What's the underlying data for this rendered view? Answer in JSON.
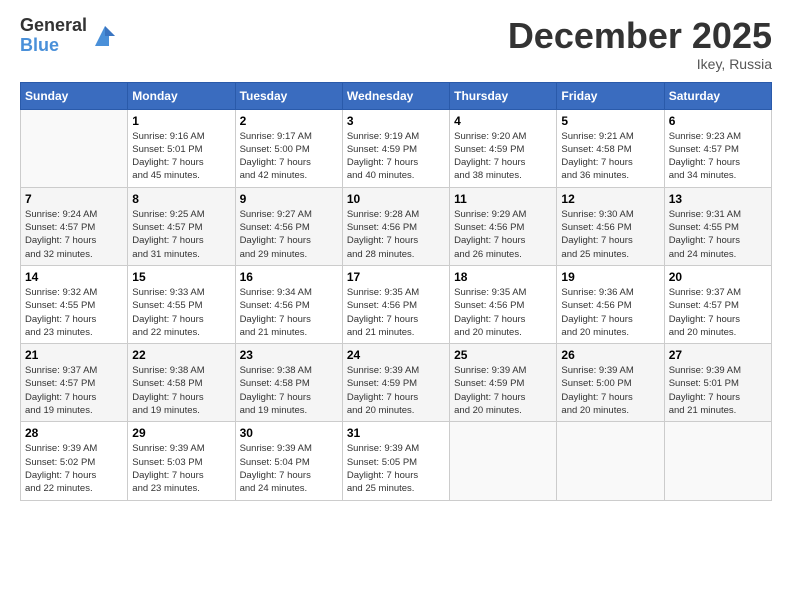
{
  "header": {
    "logo_general": "General",
    "logo_blue": "Blue",
    "title": "December 2025",
    "location": "Ikey, Russia"
  },
  "days_of_week": [
    "Sunday",
    "Monday",
    "Tuesday",
    "Wednesday",
    "Thursday",
    "Friday",
    "Saturday"
  ],
  "weeks": [
    {
      "days": [
        {
          "num": "",
          "info": ""
        },
        {
          "num": "1",
          "info": "Sunrise: 9:16 AM\nSunset: 5:01 PM\nDaylight: 7 hours\nand 45 minutes."
        },
        {
          "num": "2",
          "info": "Sunrise: 9:17 AM\nSunset: 5:00 PM\nDaylight: 7 hours\nand 42 minutes."
        },
        {
          "num": "3",
          "info": "Sunrise: 9:19 AM\nSunset: 4:59 PM\nDaylight: 7 hours\nand 40 minutes."
        },
        {
          "num": "4",
          "info": "Sunrise: 9:20 AM\nSunset: 4:59 PM\nDaylight: 7 hours\nand 38 minutes."
        },
        {
          "num": "5",
          "info": "Sunrise: 9:21 AM\nSunset: 4:58 PM\nDaylight: 7 hours\nand 36 minutes."
        },
        {
          "num": "6",
          "info": "Sunrise: 9:23 AM\nSunset: 4:57 PM\nDaylight: 7 hours\nand 34 minutes."
        }
      ]
    },
    {
      "days": [
        {
          "num": "7",
          "info": "Sunrise: 9:24 AM\nSunset: 4:57 PM\nDaylight: 7 hours\nand 32 minutes."
        },
        {
          "num": "8",
          "info": "Sunrise: 9:25 AM\nSunset: 4:57 PM\nDaylight: 7 hours\nand 31 minutes."
        },
        {
          "num": "9",
          "info": "Sunrise: 9:27 AM\nSunset: 4:56 PM\nDaylight: 7 hours\nand 29 minutes."
        },
        {
          "num": "10",
          "info": "Sunrise: 9:28 AM\nSunset: 4:56 PM\nDaylight: 7 hours\nand 28 minutes."
        },
        {
          "num": "11",
          "info": "Sunrise: 9:29 AM\nSunset: 4:56 PM\nDaylight: 7 hours\nand 26 minutes."
        },
        {
          "num": "12",
          "info": "Sunrise: 9:30 AM\nSunset: 4:56 PM\nDaylight: 7 hours\nand 25 minutes."
        },
        {
          "num": "13",
          "info": "Sunrise: 9:31 AM\nSunset: 4:55 PM\nDaylight: 7 hours\nand 24 minutes."
        }
      ]
    },
    {
      "days": [
        {
          "num": "14",
          "info": "Sunrise: 9:32 AM\nSunset: 4:55 PM\nDaylight: 7 hours\nand 23 minutes."
        },
        {
          "num": "15",
          "info": "Sunrise: 9:33 AM\nSunset: 4:55 PM\nDaylight: 7 hours\nand 22 minutes."
        },
        {
          "num": "16",
          "info": "Sunrise: 9:34 AM\nSunset: 4:56 PM\nDaylight: 7 hours\nand 21 minutes."
        },
        {
          "num": "17",
          "info": "Sunrise: 9:35 AM\nSunset: 4:56 PM\nDaylight: 7 hours\nand 21 minutes."
        },
        {
          "num": "18",
          "info": "Sunrise: 9:35 AM\nSunset: 4:56 PM\nDaylight: 7 hours\nand 20 minutes."
        },
        {
          "num": "19",
          "info": "Sunrise: 9:36 AM\nSunset: 4:56 PM\nDaylight: 7 hours\nand 20 minutes."
        },
        {
          "num": "20",
          "info": "Sunrise: 9:37 AM\nSunset: 4:57 PM\nDaylight: 7 hours\nand 20 minutes."
        }
      ]
    },
    {
      "days": [
        {
          "num": "21",
          "info": "Sunrise: 9:37 AM\nSunset: 4:57 PM\nDaylight: 7 hours\nand 19 minutes."
        },
        {
          "num": "22",
          "info": "Sunrise: 9:38 AM\nSunset: 4:58 PM\nDaylight: 7 hours\nand 19 minutes."
        },
        {
          "num": "23",
          "info": "Sunrise: 9:38 AM\nSunset: 4:58 PM\nDaylight: 7 hours\nand 19 minutes."
        },
        {
          "num": "24",
          "info": "Sunrise: 9:39 AM\nSunset: 4:59 PM\nDaylight: 7 hours\nand 20 minutes."
        },
        {
          "num": "25",
          "info": "Sunrise: 9:39 AM\nSunset: 4:59 PM\nDaylight: 7 hours\nand 20 minutes."
        },
        {
          "num": "26",
          "info": "Sunrise: 9:39 AM\nSunset: 5:00 PM\nDaylight: 7 hours\nand 20 minutes."
        },
        {
          "num": "27",
          "info": "Sunrise: 9:39 AM\nSunset: 5:01 PM\nDaylight: 7 hours\nand 21 minutes."
        }
      ]
    },
    {
      "days": [
        {
          "num": "28",
          "info": "Sunrise: 9:39 AM\nSunset: 5:02 PM\nDaylight: 7 hours\nand 22 minutes."
        },
        {
          "num": "29",
          "info": "Sunrise: 9:39 AM\nSunset: 5:03 PM\nDaylight: 7 hours\nand 23 minutes."
        },
        {
          "num": "30",
          "info": "Sunrise: 9:39 AM\nSunset: 5:04 PM\nDaylight: 7 hours\nand 24 minutes."
        },
        {
          "num": "31",
          "info": "Sunrise: 9:39 AM\nSunset: 5:05 PM\nDaylight: 7 hours\nand 25 minutes."
        },
        {
          "num": "",
          "info": ""
        },
        {
          "num": "",
          "info": ""
        },
        {
          "num": "",
          "info": ""
        }
      ]
    }
  ]
}
